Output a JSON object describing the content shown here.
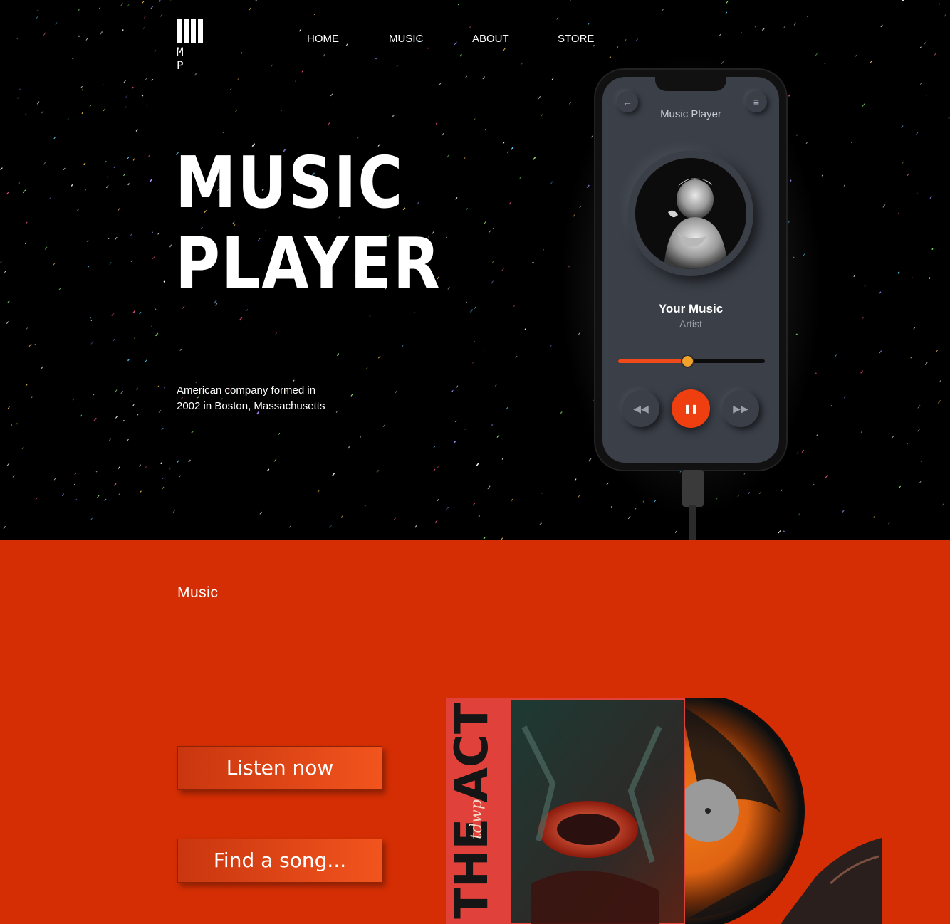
{
  "nav": {
    "logo_letters": "M P",
    "items": [
      {
        "label": "HOME"
      },
      {
        "label": "MUSIC"
      },
      {
        "label": "ABOUT"
      },
      {
        "label": "STORE"
      }
    ]
  },
  "hero": {
    "title_line1": "MUSIC",
    "title_line2": "PLAYER",
    "tagline": "American company formed in 2002 in Boston, Massachusetts"
  },
  "player": {
    "screen_title": "Music Player",
    "song_title": "Your Music",
    "artist": "Artist",
    "progress": 0.47,
    "back_icon": "arrow-left-icon",
    "menu_icon": "menu-icon",
    "prev_icon": "rewind-icon",
    "play_icon": "pause-icon",
    "next_icon": "fast-forward-icon",
    "accent_color": "#ef3f10",
    "knob_color": "#f0a22a"
  },
  "music_section": {
    "title": "Music",
    "listen_button": "Listen now",
    "find_button": "Find a song...",
    "album_side_text": "THE ACT",
    "album_band_mark": "tdwp",
    "background_color": "#d52e04"
  }
}
